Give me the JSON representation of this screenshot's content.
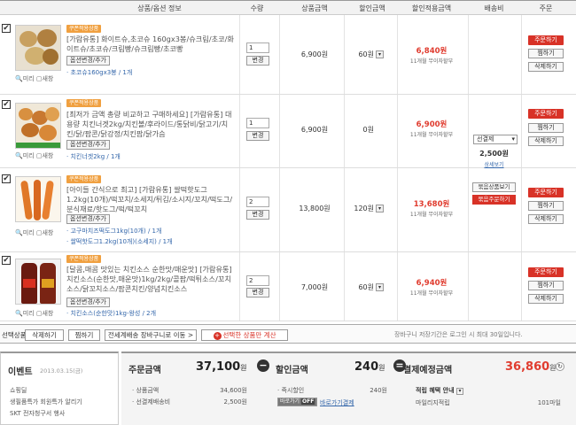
{
  "header": {
    "product_info": "상품/옵션 정보",
    "qty": "수량",
    "price": "상품금액",
    "discount": "할인금액",
    "final_price": "할인적용금액",
    "shipping": "배송비",
    "order": "주문"
  },
  "items": [
    {
      "badge": "쿠폰적용상품",
      "name": "[가람유통] 화이트슈,초코슈 160gx3봉/슈크림/초코/화이트슈/초코슈/크림빵/슈크림빵/초코빵",
      "option_button": "옵션변경/추가",
      "option": "초코슈160gx3봉 / 1개",
      "mini": "미리",
      "save": "새창",
      "qty": "1",
      "change": "변경",
      "price": "6,900원",
      "discount": "60원",
      "discount_dropdown": "▾",
      "final": "6,840원",
      "installment": "11개월 무이자할부"
    },
    {
      "badge": "쿠폰적용상품",
      "name": "[최저가 금액 총량 비교하고 구매하세요] [가람유통] 대용량 치킨너겟2kg/치킨볼/후라이드/통닭비/닭고기/치킨/닭/팝콘/닭강정/치킨팝/닭가슴",
      "option_button": "옵션변경/추가",
      "option": "치킨너겟2kg / 1개",
      "mini": "미리",
      "save": "새창",
      "qty": "1",
      "change": "변경",
      "price": "6,900원",
      "discount": "0원",
      "final": "6,900원",
      "installment": "11개월 무이자할부"
    },
    {
      "badge": "쿠폰적용상품",
      "name": "[아이들 간식으로 최고] [가람유통] 쌀떡핫도그1.2kg(10개)/떡꼬치/소세지/튀김/소시지/꼬치/떡도그/분식재료/핫도그/떡/떡꼬치",
      "option_button": "옵션변경/추가",
      "option": "고구마치즈떡도그1kg(10개) / 1개",
      "option2": "쌀떡핫도그1.2kg(10개)(소세지) / 1개",
      "mini": "미리",
      "save": "새창",
      "qty": "2",
      "change": "변경",
      "price": "13,800원",
      "discount": "120원",
      "discount_dropdown": "▾",
      "final": "13,680원",
      "installment": "11개월 무이자할부"
    },
    {
      "badge": "쿠폰적용상품",
      "name": "[달콤,매콤 맛있는 치킨소스 순한맛/매운맛] [가람유통] 치킨소스(순한맛,매운맛)1kg/2kg/콜팝/떡튀소스/꼬치소스/닭꼬치소스/팝콘치킨/양념치킨소스",
      "option_button": "옵션변경/추가",
      "option": "치킨소스(순한맛)1kg-왕성 / 2개",
      "mini": "미리",
      "save": "새창",
      "qty": "2",
      "change": "변경",
      "price": "7,000원",
      "discount": "60원",
      "discount_dropdown": "▾",
      "final": "6,940원",
      "installment": "11개월 무이자할부"
    }
  ],
  "row_buttons": {
    "order": "주문하기",
    "wish": "찜하기",
    "delete": "삭제하기"
  },
  "shipping": {
    "select": "선결제",
    "amount": "2,500원",
    "detail": "상세보기",
    "bundle": "묶음상품보기",
    "bundle_order": "묶음주문하기"
  },
  "bar": {
    "label": "선택상품",
    "delete": "삭제하기",
    "wish": "찜하기",
    "move": "전세계배송 장바구니로 이동 >",
    "calc": "선택한 상품만 계산",
    "note": "장바구니 저장기간은 로그인 시 최대 30일입니다."
  },
  "event": {
    "title": "이벤트",
    "date": "2013.03.15(금)",
    "items": [
      "쇼핑딜",
      "생필품특가 회원특가 알리기",
      "SKT 전자청구서 행사"
    ]
  },
  "summary": {
    "order_label": "주문금액",
    "order_value": "37,100",
    "unit": "원",
    "discount_label": "할인금액",
    "discount_value": "240",
    "final_label": "결제예정금액",
    "final_value": "36,860",
    "product_amount_label": "상품금액",
    "product_amount": "34,600원",
    "shipping_label": "선결제배송비",
    "shipping_amount": "2,500원",
    "instant_label": "즉시할인",
    "instant_amount": "240원",
    "pay_label": "바로가기",
    "pay_off": "OFF",
    "pay_link": "바로가기결제",
    "benefit_label": "적립 혜택 안내",
    "mileage_label": "마일리지적립",
    "mileage_value": "101마일"
  }
}
